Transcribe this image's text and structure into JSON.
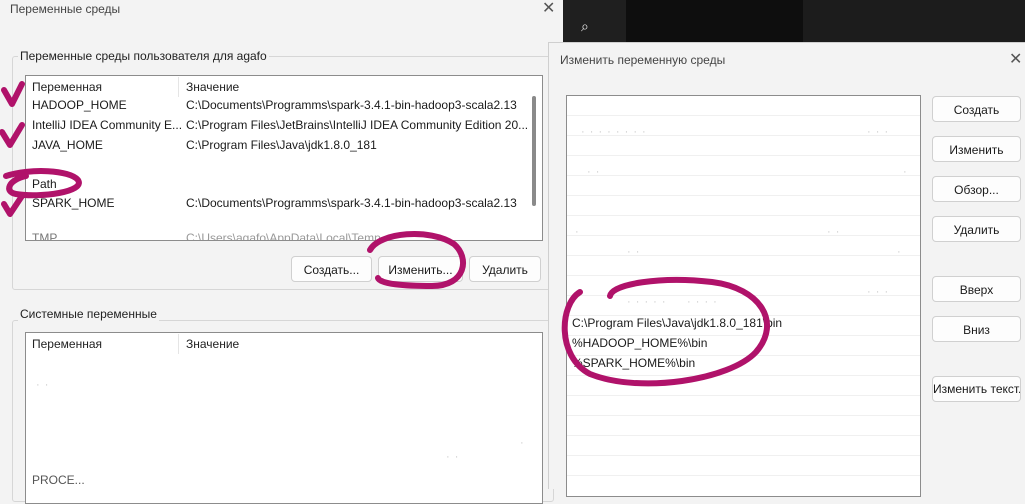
{
  "left_dialog": {
    "title": "Переменные среды",
    "user_group_label": "Переменные среды пользователя для agafo",
    "user_columns": [
      "Переменная",
      "Значение"
    ],
    "user_rows": [
      {
        "name": "HADOOP_HOME",
        "value": "C:\\Documents\\Programms\\spark-3.4.1-bin-hadoop3-scala2.13"
      },
      {
        "name": "IntelliJ IDEA Community E...",
        "value": "C:\\Program Files\\JetBrains\\IntelliJ IDEA Community Edition 20..."
      },
      {
        "name": "JAVA_HOME",
        "value": "C:\\Program Files\\Java\\jdk1.8.0_181"
      },
      {
        "name": "",
        "value": ""
      },
      {
        "name": "Path",
        "value": ""
      },
      {
        "name": "SPARK_HOME",
        "value": "C:\\Documents\\Programms\\spark-3.4.1-bin-hadoop3-scala2.13"
      },
      {
        "name": "",
        "value": ""
      },
      {
        "name": "TMP",
        "value": "C:\\Users\\agafo\\AppData\\Local\\Temp"
      }
    ],
    "buttons": {
      "create": "Создать...",
      "edit": "Изменить...",
      "delete": "Удалить"
    },
    "system_group_label": "Системные переменные",
    "system_columns": [
      "Переменная",
      "Значение"
    ],
    "system_bottom_text": "PROCE..."
  },
  "edit_dialog": {
    "title": "Изменить переменную среды",
    "entries": [
      "",
      "",
      "",
      "",
      "",
      "",
      "",
      "",
      "",
      "",
      "C:\\Program Files\\Java\\jdk1.8.0_181\\bin",
      "%HADOOP_HOME%\\bin",
      "%SPARK_HOME%\\bin"
    ],
    "buttons": {
      "create": "Создать",
      "edit": "Изменить",
      "browse": "Обзор...",
      "delete": "Удалить",
      "up": "Вверх",
      "down": "Вниз",
      "edit_text": "Изменить текст..."
    }
  },
  "taskbar": {
    "search_glyph": "⌕"
  },
  "colors": {
    "annotation": "#b0126a",
    "dialog_bg": "#f3f3f3",
    "list_border": "#8c8c8c"
  }
}
